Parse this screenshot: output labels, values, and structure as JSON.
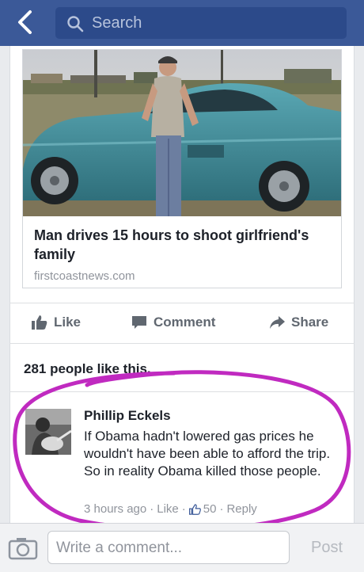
{
  "search": {
    "placeholder": "Search"
  },
  "link_preview": {
    "headline": "Man drives 15 hours to shoot girlfriend's family",
    "domain": "firstcoastnews.com"
  },
  "actions": {
    "like": "Like",
    "comment": "Comment",
    "share": "Share"
  },
  "likes_summary": "281 people like this.",
  "comment": {
    "author": "Phillip Eckels",
    "text": "If Obama hadn't lowered gas prices he wouldn't have been able to afford the trip.  So in reality Obama killed those people.",
    "time": "3 hours ago",
    "like_label": "Like",
    "like_count": "50",
    "reply_label": "Reply"
  },
  "composer": {
    "placeholder": "Write a comment...",
    "post_label": "Post"
  },
  "colors": {
    "topbar": "#3b5998",
    "highlight_circle": "#c02ac0"
  },
  "icons": [
    "back-chevron-icon",
    "search-icon",
    "thumbs-up-icon",
    "comment-bubble-icon",
    "share-arrow-icon",
    "camera-icon"
  ]
}
